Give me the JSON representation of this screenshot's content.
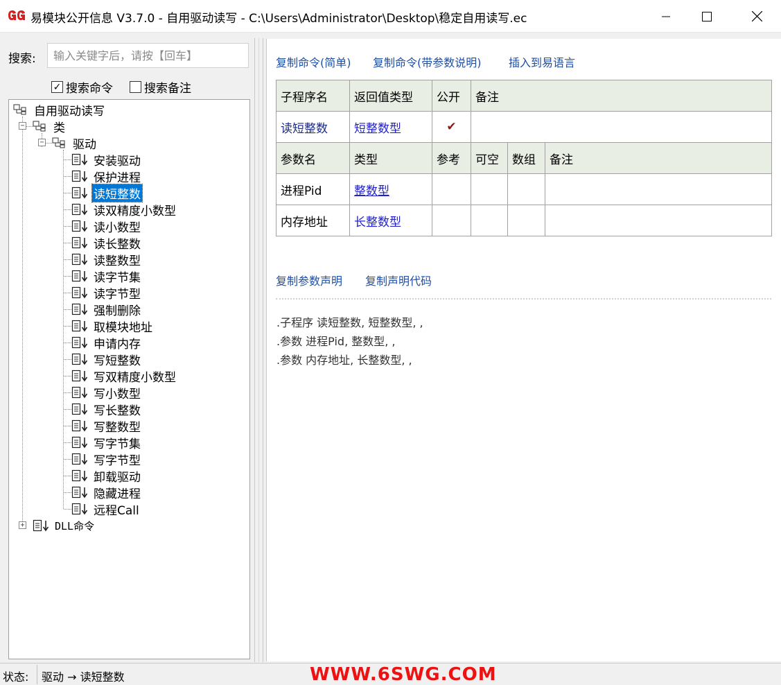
{
  "window": {
    "title": "易模块公开信息 V3.7.0 - 自用驱动读写 - C:\\Users\\Administrator\\Desktop\\稳定自用读写.ec"
  },
  "search": {
    "label": "搜索:",
    "placeholder": "输入关键字后，请按【回车】",
    "search_commands_label": "搜索命令",
    "search_commands_checked": true,
    "search_notes_label": "搜索备注",
    "search_notes_checked": false
  },
  "tree": {
    "root": "自用驱动读写",
    "class_group": "类",
    "class_name": "驱动",
    "methods": [
      "安装驱动",
      "保护进程",
      "读短整数",
      "读双精度小数型",
      "读小数型",
      "读长整数",
      "读整数型",
      "读字节集",
      "读字节型",
      "强制删除",
      "取模块地址",
      "申请内存",
      "写短整数",
      "写双精度小数型",
      "写小数型",
      "写长整数",
      "写整数型",
      "写字节集",
      "写字节型",
      "卸载驱动",
      "隐藏进程",
      "远程Call"
    ],
    "selected_method": "读短整数",
    "dll_group": "DLL命令"
  },
  "detail": {
    "links": {
      "copy_simple": "复制命令(简单)",
      "copy_with_params": "复制命令(带参数说明)",
      "insert": "插入到易语言"
    },
    "sub_header": {
      "name": "子程序名",
      "return_type": "返回值类型",
      "public": "公开",
      "note": "备注"
    },
    "sub": {
      "name": "读短整数",
      "return_type": "短整数型",
      "public_mark": "✔",
      "note": ""
    },
    "param_header": {
      "name": "参数名",
      "type": "类型",
      "ref": "参考",
      "nullable": "可空",
      "array": "数组",
      "note": "备注"
    },
    "params": [
      {
        "name": "进程Pid",
        "type": "整数型"
      },
      {
        "name": "内存地址",
        "type": "长整数型"
      }
    ],
    "decl_links": {
      "copy_params": "复制参数声明",
      "copy_decl": "复制声明代码"
    },
    "code": [
      ".子程序 读短整数, 短整数型, ,",
      ".参数 进程Pid, 整数型, ,",
      ".参数 内存地址, 长整数型, ,"
    ]
  },
  "status": {
    "label": "状态:",
    "text": "驱动 → 读短整数",
    "watermark": "WWW.6SWG.COM"
  },
  "colors": {
    "link": "#1f4fa5",
    "type_link": "#2020cc",
    "selection": "#0078d7",
    "header_bg": "#e8eee4",
    "watermark": "#ee1111"
  }
}
